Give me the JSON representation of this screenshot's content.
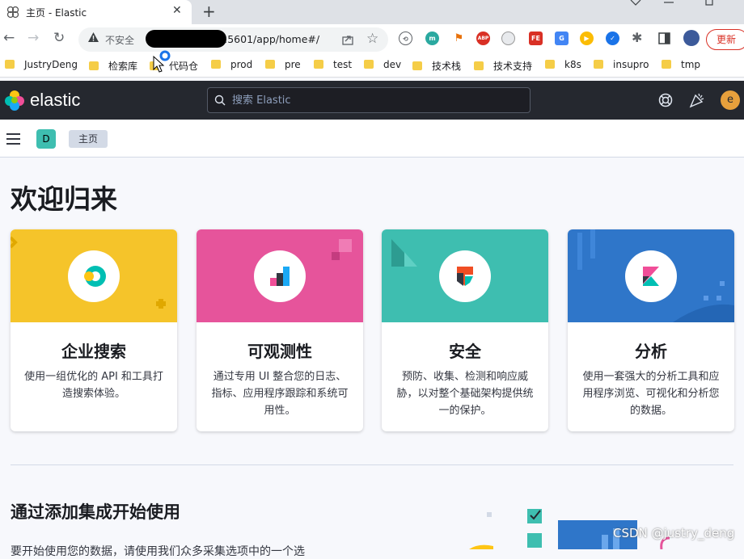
{
  "browser": {
    "tab_title": "主页 - Elastic",
    "address_warning": "不安全",
    "address_url": ":5601/app/home#/",
    "update_label": "更新",
    "bookmarks": [
      "JustryDeng",
      "检索库",
      "代码仓",
      "prod",
      "pre",
      "test",
      "dev",
      "技术栈",
      "技术支持",
      "k8s",
      "insupro",
      "tmp"
    ]
  },
  "kibana": {
    "logo_text": "elastic",
    "search_placeholder": "搜索 Elastic",
    "user_initial": "e",
    "space_initial": "D",
    "breadcrumb": "主页"
  },
  "main": {
    "welcome": "欢迎归来",
    "cards": [
      {
        "title": "企业搜索",
        "desc": "使用一组优化的 API 和工具打造搜索体验。",
        "color": "#f5c42a"
      },
      {
        "title": "可观测性",
        "desc": "通过专用 UI 整合您的日志、指标、应用程序跟踪和系统可用性。",
        "color": "#e6549b"
      },
      {
        "title": "安全",
        "desc": "预防、收集、检测和响应威胁，以对整个基础架构提供统一的保护。",
        "color": "#3ebeb0"
      },
      {
        "title": "分析",
        "desc": "使用一套强大的分析工具和应用程序浏览、可视化和分析您的数据。",
        "color": "#2f76c9"
      }
    ],
    "integrations_title": "通过添加集成开始使用",
    "integrations_desc": "要开始使用您的数据，请使用我们众多采集选项中的一个选"
  },
  "watermark": "CSDN @justry_deng"
}
